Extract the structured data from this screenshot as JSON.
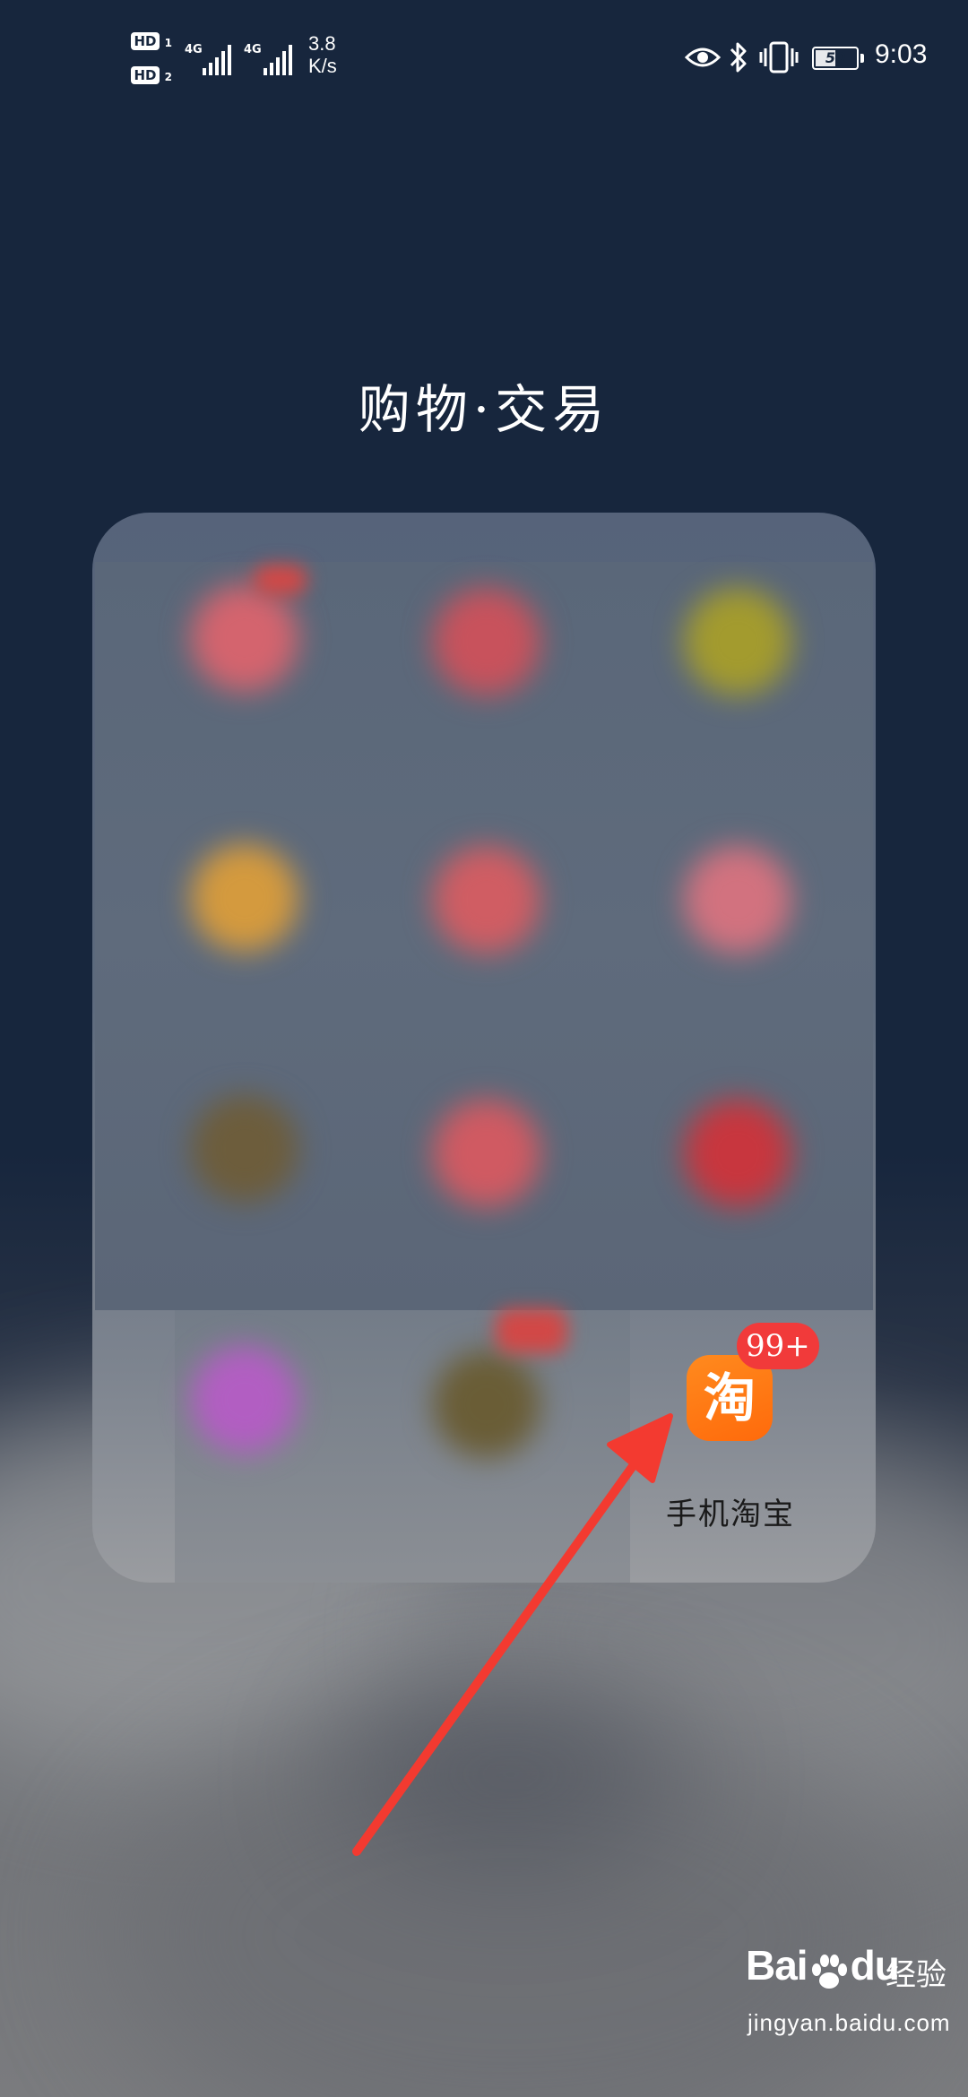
{
  "status_bar": {
    "sim1_tag": "HD",
    "sim1_index": "1",
    "sim2_tag": "HD",
    "sim2_index": "2",
    "sim1_network": "4G",
    "sim2_network": "4G",
    "net_speed_value": "3.8",
    "net_speed_unit": "K/s",
    "battery_level": "50",
    "battery_fraction": 0.5,
    "time": "9:03",
    "icons": [
      "eye-comfort-icon",
      "bluetooth-icon",
      "vibrate-icon",
      "battery-icon"
    ]
  },
  "folder": {
    "title": "购物·交易",
    "apps": [
      {
        "label": "手机淘宝",
        "icon_glyph": "淘",
        "badge": "99+",
        "color": "#ff7a10"
      }
    ]
  },
  "watermark": {
    "brand_left": "Bai",
    "brand_right": "du",
    "suffix": "经验",
    "url": "jingyan.baidu.com"
  },
  "colors": {
    "background": "#17263d",
    "badge_red": "#f13a3a",
    "annotation_arrow": "#f33a30",
    "taobao_orange": "#ff7a10"
  }
}
